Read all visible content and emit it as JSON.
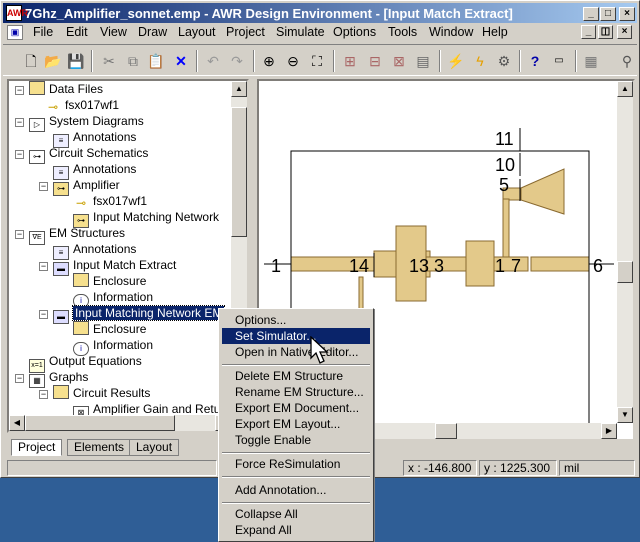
{
  "window": {
    "title": "7Ghz_Amplifier_sonnet.emp - AWR Design Environment - [Input Match Extract]",
    "icon_label": "AWR"
  },
  "menu": {
    "items": [
      "File",
      "Edit",
      "View",
      "Draw",
      "Layout",
      "Project",
      "Simulate",
      "Options",
      "Tools",
      "Window",
      "Help"
    ]
  },
  "tree": {
    "nodes": [
      {
        "label": "Data Files",
        "icon": "folder-icon"
      },
      {
        "label": "fsx017wf1",
        "icon": "data-file-icon"
      },
      {
        "label": "System Diagrams",
        "icon": "system-diagram-icon"
      },
      {
        "label": "Annotations",
        "icon": "annotations-icon"
      },
      {
        "label": "Circuit Schematics",
        "icon": "schematic-icon"
      },
      {
        "label": "Annotations",
        "icon": "annotations-icon"
      },
      {
        "label": "Amplifier",
        "icon": "schematic-icon"
      },
      {
        "label": "fsx017wf1",
        "icon": "data-file-icon"
      },
      {
        "label": "Input Matching Network",
        "icon": "schematic-icon"
      },
      {
        "label": "EM Structures",
        "icon": "em-structures-icon"
      },
      {
        "label": "Annotations",
        "icon": "annotations-icon"
      },
      {
        "label": "Input Match Extract",
        "icon": "em-structure-icon"
      },
      {
        "label": "Enclosure",
        "icon": "folder-icon"
      },
      {
        "label": "Information",
        "icon": "info-icon"
      },
      {
        "label": "Input Matching Network EM",
        "icon": "em-structure-icon"
      },
      {
        "label": "Enclosure",
        "icon": "folder-icon"
      },
      {
        "label": "Information",
        "icon": "info-icon"
      },
      {
        "label": "Output Equations",
        "icon": "equations-icon"
      },
      {
        "label": "Graphs",
        "icon": "graphs-icon"
      },
      {
        "label": "Circuit Results",
        "icon": "folder-icon"
      },
      {
        "label": "Amplifier Gain and Return",
        "icon": "graph-icon"
      }
    ]
  },
  "tabs": [
    "Project",
    "Elements",
    "Layout"
  ],
  "canvas": {
    "port_labels": [
      "11",
      "10",
      "5",
      "1",
      "14",
      "13",
      "3",
      "1",
      "7",
      "6"
    ]
  },
  "status": {
    "x_label": "x :",
    "x_value": "-146.800",
    "y_label": "y :",
    "y_value": "1225.300",
    "unit": "mil"
  },
  "context_menu": {
    "items": [
      "Options...",
      "Set Simulator...",
      "Open in Native Editor...",
      "Delete EM Structure",
      "Rename EM Structure...",
      "Export EM Document...",
      "Export EM Layout...",
      "Toggle Enable",
      "Force ReSimulation",
      "Add Annotation...",
      "Collapse All",
      "Expand All"
    ],
    "highlighted": "Set Simulator..."
  },
  "colors": {
    "title_start": "#0a246a",
    "title_end": "#a6caf0",
    "selection": "#0a246a",
    "layout_fill": "#e3c98a",
    "desktop": "#2f5e96"
  }
}
